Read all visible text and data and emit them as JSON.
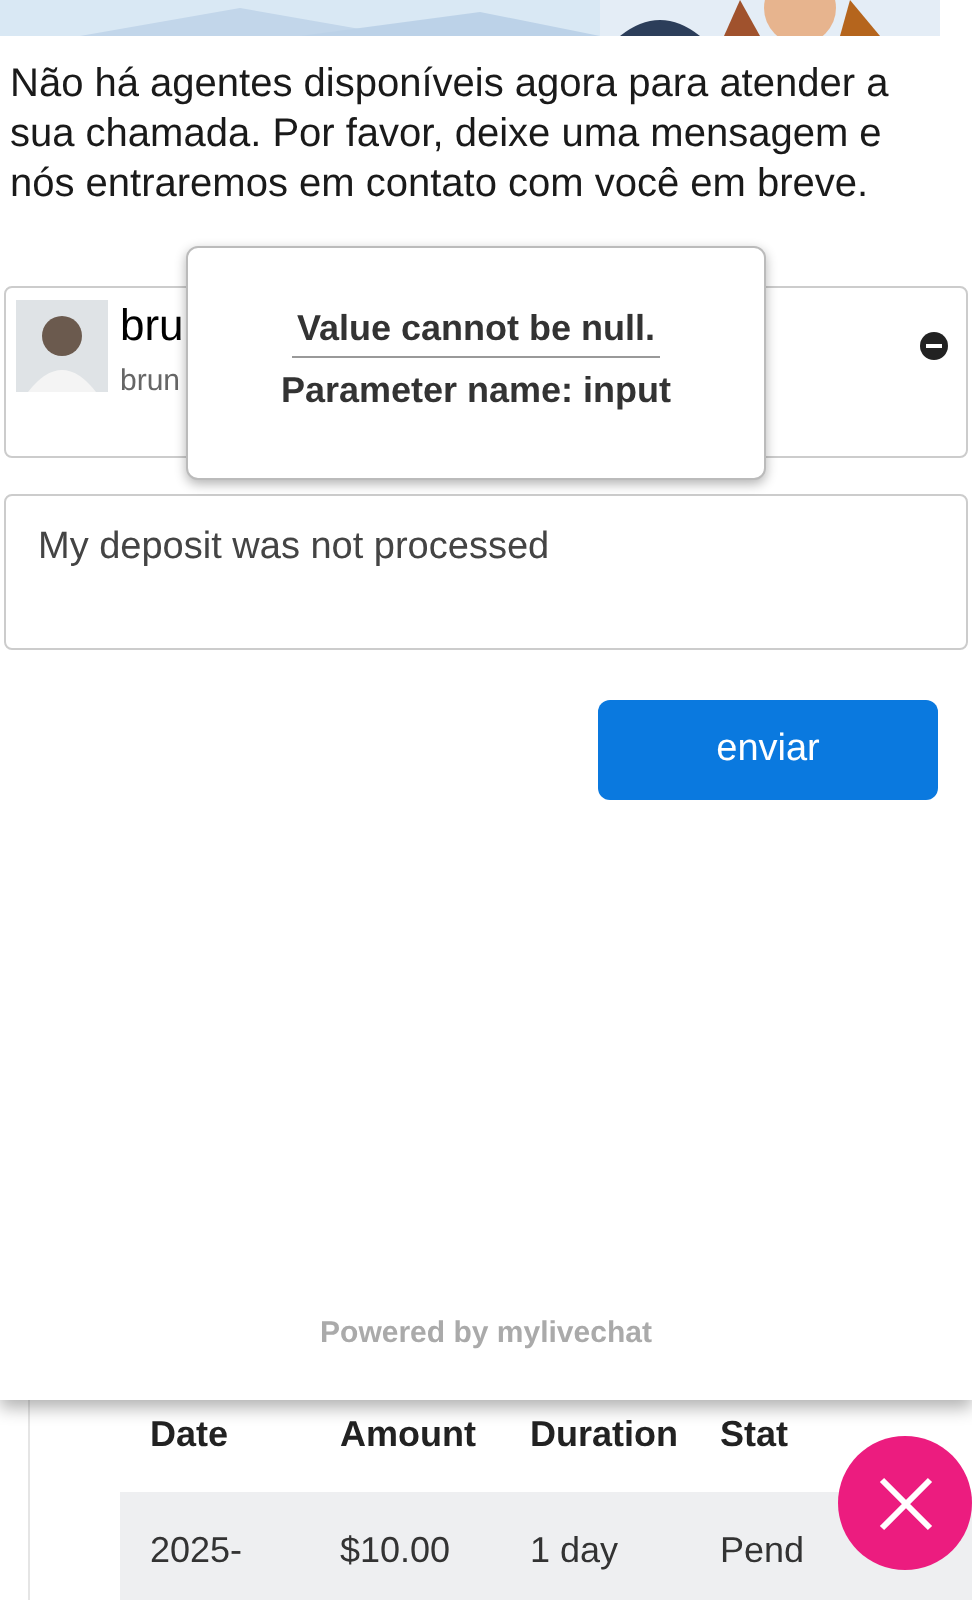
{
  "message": "Não há agentes disponíveis agora para atender a sua chamada. Por favor, deixe uma mensagem e nós entraremos em contato com você em breve.",
  "contact": {
    "name": "bru",
    "email": "brun"
  },
  "tooltip": {
    "lines": [
      "Value cannot be null.",
      "Parameter name: input"
    ]
  },
  "question": {
    "value": "My deposit was not processed"
  },
  "send_button": "enviar",
  "footer": "Powered by mylivechat",
  "table": {
    "columns": [
      "Date",
      "Amount",
      "Duration",
      "Stat"
    ],
    "rows": [
      [
        "2025-",
        "$10.00",
        "1 day",
        "Pend"
      ]
    ]
  }
}
